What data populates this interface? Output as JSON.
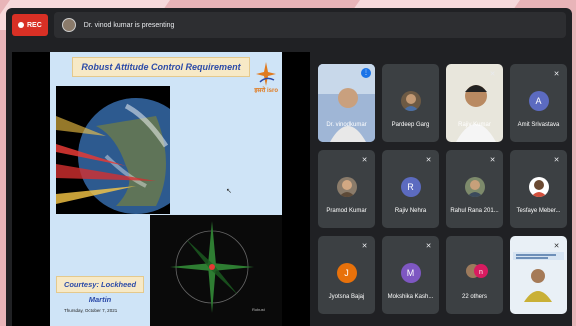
{
  "recording": {
    "label": "REC"
  },
  "presenter": {
    "text": "Dr. vinod kumar is presenting"
  },
  "slide": {
    "title": "Robust Attitude Control Requirement",
    "logo_text": "इसरो isro",
    "courtesy": "Courtesy: Lockheed Martin",
    "date": "Thursday, October 7, 2021"
  },
  "participants": [
    {
      "name": "Dr. vinodkumar",
      "kind": "video",
      "muted": false,
      "speaking": true
    },
    {
      "name": "Pardeep Garg",
      "kind": "photo",
      "muted": false
    },
    {
      "name": "Rajiv Kumar",
      "kind": "video",
      "muted": true
    },
    {
      "name": "Amit Srivastava",
      "kind": "letter",
      "letter": "A",
      "color": "#5c6bc0",
      "muted": true
    },
    {
      "name": "Pramod Kumar",
      "kind": "photo",
      "muted": true
    },
    {
      "name": "Rajiv Nehra",
      "kind": "letter",
      "letter": "R",
      "color": "#5c6bc0",
      "muted": true
    },
    {
      "name": "Rahul Rana 201...",
      "kind": "photo",
      "muted": true
    },
    {
      "name": "Tesfaye Meber...",
      "kind": "photo",
      "muted": true
    },
    {
      "name": "Jyotsna Bajaj",
      "kind": "letter",
      "letter": "J",
      "color": "#e8710a",
      "muted": true
    },
    {
      "name": "Mokshika Kash...",
      "kind": "letter",
      "letter": "M",
      "color": "#7e57c2",
      "muted": true
    },
    {
      "name": "22 others",
      "kind": "group",
      "muted": false
    },
    {
      "name": "",
      "kind": "screen",
      "muted": true
    }
  ],
  "colors": {
    "rec": "#d93025",
    "tile": "#3c4043",
    "background": "#202124",
    "active_border": "#8ab4f8"
  },
  "icons": {
    "mute": "mic-off-icon",
    "speaking": "speaking-indicator-icon",
    "rec": "record-dot-icon"
  }
}
